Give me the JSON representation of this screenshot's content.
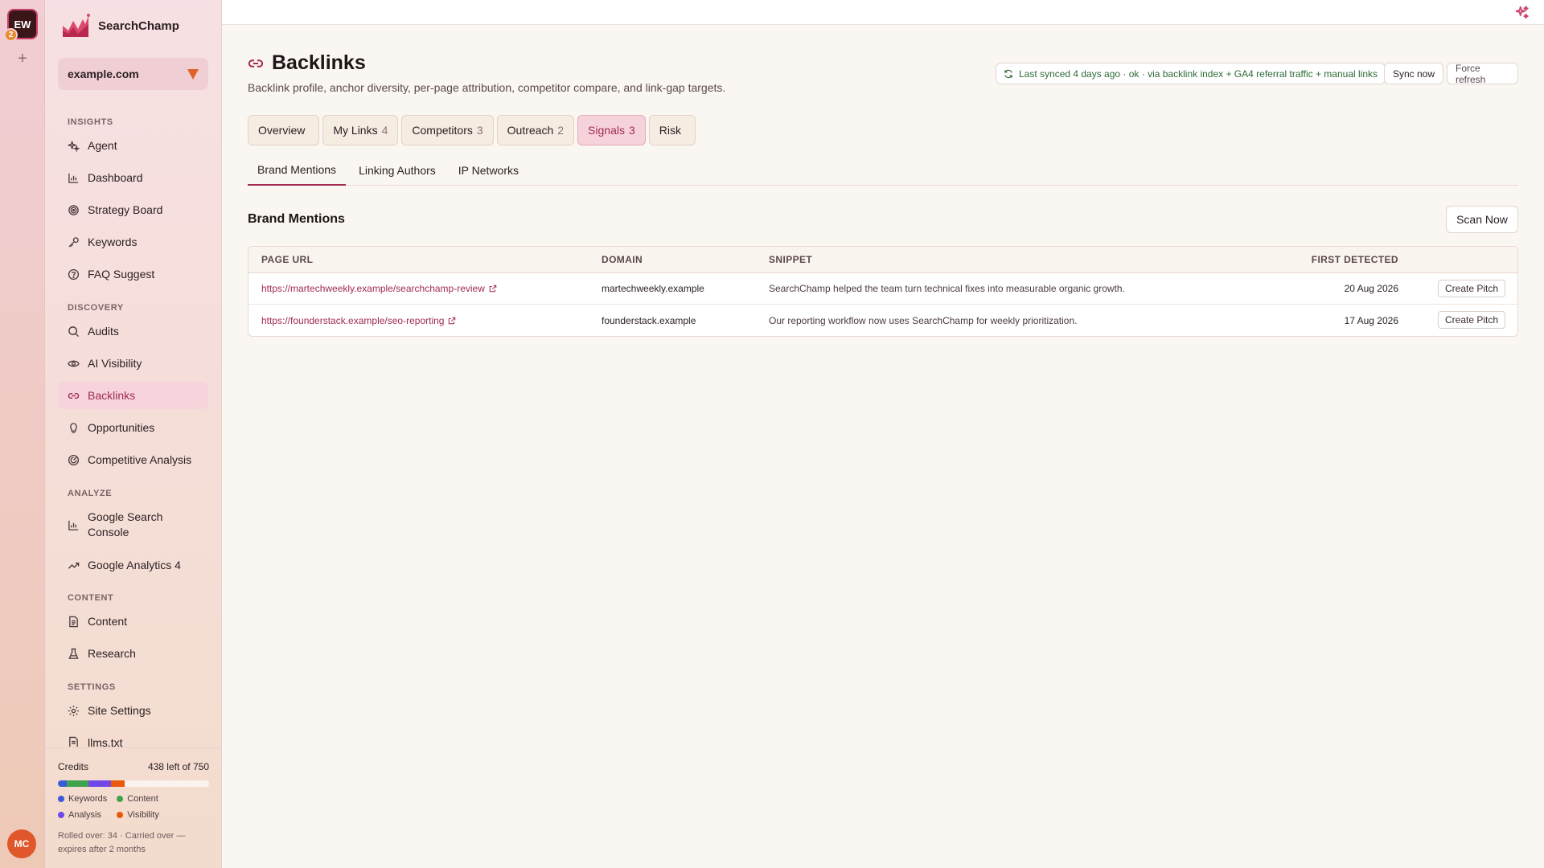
{
  "rail": {
    "workspace_initials": "EW",
    "workspace_count": "2",
    "add_label": "+",
    "user_initials": "MC"
  },
  "brand": {
    "name": "SearchChamp"
  },
  "site_selector": {
    "value": "example.com"
  },
  "sidebar": {
    "sections": {
      "insights": "INSIGHTS",
      "discovery": "DISCOVERY",
      "analyze": "ANALYZE",
      "content": "CONTENT",
      "settings": "SETTINGS"
    },
    "items": {
      "agent": "Agent",
      "dashboard": "Dashboard",
      "strategy": "Strategy Board",
      "keywords": "Keywords",
      "faq": "FAQ Suggest",
      "audits": "Audits",
      "ai_visibility": "AI Visibility",
      "backlinks": "Backlinks",
      "opportunities": "Opportunities",
      "competitive": "Competitive Analysis",
      "gsc_line1": "Google Search",
      "gsc_line2": "Console",
      "ga4": "Google Analytics 4",
      "content": "Content",
      "research": "Research",
      "site_settings": "Site Settings",
      "llms": "llms.txt"
    }
  },
  "credits": {
    "label": "Credits",
    "remaining": "438 left of 750",
    "segments": [
      {
        "name": "Keywords",
        "fraction": 0.06,
        "color": "#3b5bdb"
      },
      {
        "name": "Content",
        "fraction": 0.14,
        "color": "#3fa34d"
      },
      {
        "name": "Analysis",
        "fraction": 0.15,
        "color": "#7048e8"
      },
      {
        "name": "Visibility",
        "fraction": 0.09,
        "color": "#e8590c"
      }
    ],
    "legend": {
      "keywords": "Keywords",
      "content": "Content",
      "analysis": "Analysis",
      "visibility": "Visibility"
    },
    "rollover": "Rolled over: 34 · Carried over — expires after 2 months"
  },
  "page": {
    "title": "Backlinks",
    "subtitle": "Backlink profile, anchor diversity, per-page attribution, competitor compare, and link-gap targets.",
    "sync_status": "Last synced 4 days ago · ok · via backlink index + GA4 referral traffic + manual links",
    "sync_now": "Sync now",
    "force_refresh": "Force refresh"
  },
  "tabs": [
    {
      "label": "Overview",
      "count": ""
    },
    {
      "label": "My Links",
      "count": "4"
    },
    {
      "label": "Competitors",
      "count": "3"
    },
    {
      "label": "Outreach",
      "count": "2"
    },
    {
      "label": "Signals",
      "count": "3"
    },
    {
      "label": "Risk",
      "count": ""
    }
  ],
  "subtabs": [
    "Brand Mentions",
    "Linking Authors",
    "IP Networks"
  ],
  "mentions": {
    "title": "Brand Mentions",
    "scan_label": "Scan Now",
    "columns": {
      "url": "PAGE URL",
      "domain": "DOMAIN",
      "snippet": "SNIPPET",
      "detected": "FIRST DETECTED"
    },
    "rows": [
      {
        "url": "https://martechweekly.example/searchchamp-review",
        "domain": "martechweekly.example",
        "snippet": "SearchChamp helped the team turn technical fixes into measurable organic growth.",
        "detected": "20 Aug 2026",
        "action": "Create Pitch"
      },
      {
        "url": "https://founderstack.example/seo-reporting",
        "domain": "founderstack.example",
        "snippet": "Our reporting workflow now uses SearchChamp for weekly prioritization.",
        "detected": "17 Aug 2026",
        "action": "Create Pitch"
      }
    ]
  },
  "colors": {
    "accent": "#a12a55",
    "sync_green": "#2e6b36",
    "brand_orange": "#e0622b"
  }
}
